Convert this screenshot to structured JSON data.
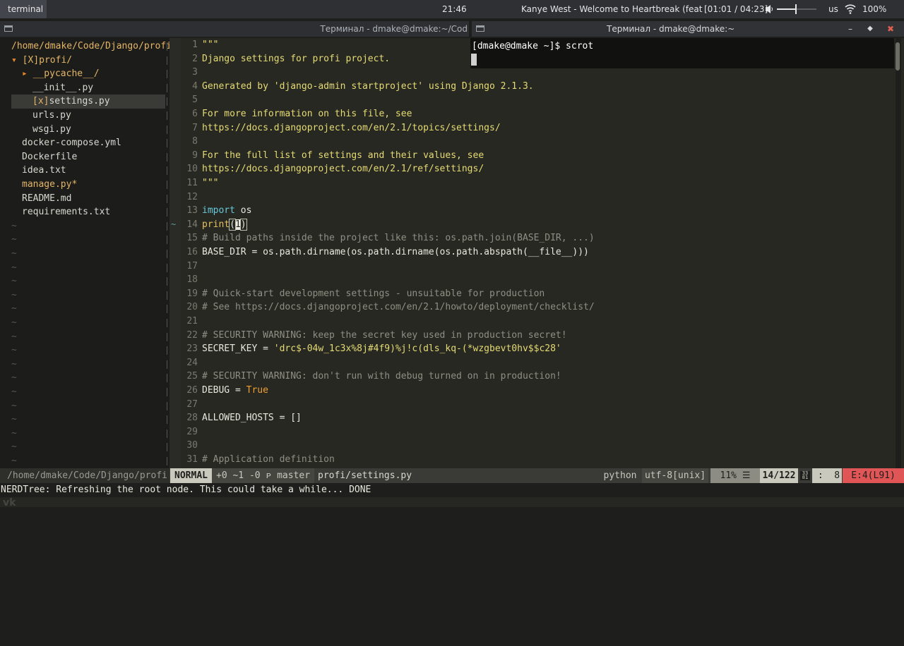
{
  "topbar": {
    "workspace": "terminal",
    "clock": "21:46",
    "now_playing": "Kanye West  -  Welcome to Heartbreak (feat",
    "track_time": "[01:01 / 04:23]",
    "volume_level": 0.47,
    "keyboard_layout": "us",
    "battery": "100%"
  },
  "windows": {
    "left_title": "Терминал - dmake@dmake:~/Cod",
    "right_title": "Терминал - dmake@dmake:~"
  },
  "terminal": {
    "prompt": "[dmake@dmake ~]$ scrot"
  },
  "nerdtree": {
    "items": [
      "/home/dmake/Code/Django/profi",
      "▾ [X]profi/",
      "▸ __pycache__/",
      "__init__.py",
      "[x]settings.py",
      "urls.py",
      "wsgi.py",
      "docker-compose.yml",
      "Dockerfile",
      "idea.txt",
      "manage.py*",
      "README.md",
      "requirements.txt"
    ]
  },
  "editor": {
    "lines": [
      {
        "n": "1",
        "t": "\"\"\""
      },
      {
        "n": "2",
        "t": "Django settings for profi project."
      },
      {
        "n": "3",
        "t": ""
      },
      {
        "n": "4",
        "t": "Generated by 'django-admin startproject' using Django 2.1.3."
      },
      {
        "n": "5",
        "t": ""
      },
      {
        "n": "6",
        "t": "For more information on this file, see"
      },
      {
        "n": "7",
        "t": "https://docs.djangoproject.com/en/2.1/topics/settings/"
      },
      {
        "n": "8",
        "t": ""
      },
      {
        "n": "9",
        "t": "For the full list of settings and their values, see"
      },
      {
        "n": "10",
        "t": "https://docs.djangoproject.com/en/2.1/ref/settings/"
      },
      {
        "n": "11",
        "t": "\"\"\""
      },
      {
        "n": "12",
        "t": ""
      },
      {
        "n": "13",
        "kw": "import",
        "rest": " os"
      },
      {
        "n": "14",
        "fn": "print",
        "a": "(",
        "b": "1",
        "c": ")"
      },
      {
        "n": "15",
        "t": "# Build paths inside the project like this: os.path.join(BASE_DIR, ...)"
      },
      {
        "n": "16",
        "t": "BASE_DIR = os.path.dirname(os.path.dirname(os.path.abspath(__file__)))"
      },
      {
        "n": "17",
        "t": ""
      },
      {
        "n": "18",
        "t": ""
      },
      {
        "n": "19",
        "t": "# Quick-start development settings - unsuitable for production"
      },
      {
        "n": "20",
        "t": "# See https://docs.djangoproject.com/en/2.1/howto/deployment/checklist/"
      },
      {
        "n": "21",
        "t": ""
      },
      {
        "n": "22",
        "t": "# SECURITY WARNING: keep the secret key used in production secret!"
      },
      {
        "n": "23",
        "var": "SECRET_KEY",
        "eq": " = ",
        "str": "'drc$-04w_1c3x%8j#4f9)%j!c(dls_kq-(*wzgbevt0hv$$c28'"
      },
      {
        "n": "24",
        "t": ""
      },
      {
        "n": "25",
        "t": "# SECURITY WARNING: don't run with debug turned on in production!"
      },
      {
        "n": "26",
        "var": "DEBUG",
        "eq": " = ",
        "kw2": "True"
      },
      {
        "n": "27",
        "t": ""
      },
      {
        "n": "28",
        "t": "ALLOWED_HOSTS = []"
      },
      {
        "n": "29",
        "t": ""
      },
      {
        "n": "30",
        "t": ""
      },
      {
        "n": "31",
        "t": "# Application definition"
      }
    ]
  },
  "statusline": {
    "path": "/home/dmake/Code/Django/profi",
    "mode": "NORMAL",
    "git": "+0 ~1 -0 ᴘ master",
    "file": "profi/settings.py",
    "filetype": "python",
    "encoding": "utf-8[unix]",
    "percent": "11% ☰",
    "line": "14/122",
    "col": " :  8",
    "errors": "E:4(L91)"
  },
  "cmdline": "NERDTree: Refreshing the root node. This could take a while... DONE"
}
